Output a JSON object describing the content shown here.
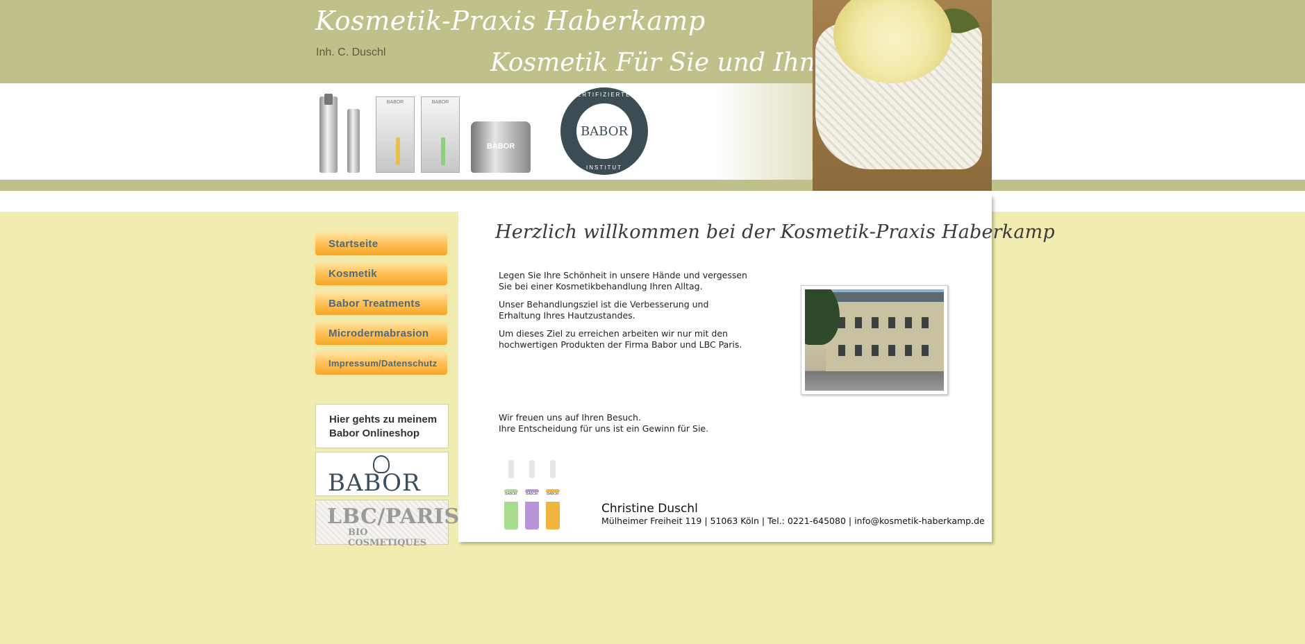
{
  "header": {
    "site_title": "Kosmetik-Praxis Haberkamp",
    "owner": "Inh. C. Duschl",
    "tagline": "Kosmetik Für Sie und Ihn",
    "product_brand": "BABOR",
    "seal": {
      "brand": "BABOR",
      "top_text": "ZERTIFIZIERTES",
      "bottom_text": "INSTITUT"
    }
  },
  "nav": {
    "items": [
      {
        "label": "Startseite"
      },
      {
        "label": "Kosmetik"
      },
      {
        "label": "Babor Treatments"
      },
      {
        "label": "Microdermabrasion"
      },
      {
        "label": "Impressum/Datenschutz"
      }
    ]
  },
  "banners": {
    "shop_line1": "Hier gehts zu meinem",
    "shop_line2": "Babor Onlineshop",
    "babor_logo": "BABOR",
    "lbc_logo": "LBC/PARIS",
    "lbc_sub": "BIO COSMETIQUES"
  },
  "content": {
    "welcome": "Herzlich willkommen bei der Kosmetik-Praxis Haberkamp",
    "p1": "Legen Sie Ihre Schönheit in unsere Hände und vergessen Sie bei einer Kosmetikbehandlung Ihren Alltag.",
    "p2": "Unser Behandlungsziel ist die Verbesserung und Erhaltung Ihres Hautzustandes.",
    "p3": "Um dieses Ziel zu erreichen arbeiten wir nur mit den hochwertigen Produkten der Firma Babor und LBC Paris.",
    "p4_line1": "Wir freuen uns auf Ihren Besuch.",
    "p4_line2": "Ihre Entscheidung für uns ist ein Gewinn für Sie.",
    "ampoule_brand": "BABOR"
  },
  "signature": {
    "name": "Christine Duschl",
    "address": "Mülheimer Freiheit 119 | 51063 Köln | Tel.: 0221-645080 | info@kosmetik-haberkamp.de"
  }
}
